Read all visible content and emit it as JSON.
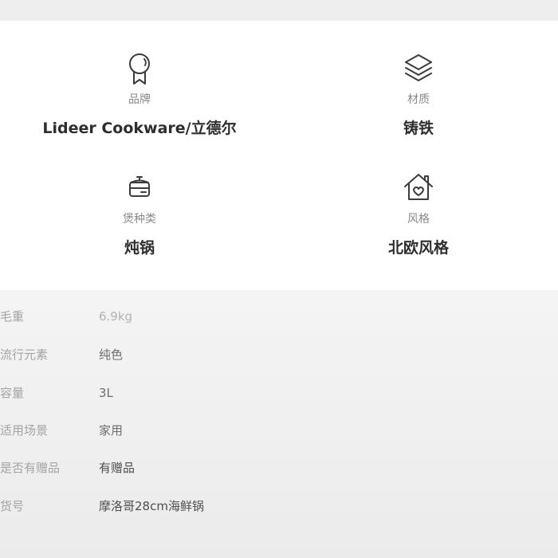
{
  "attributes": [
    {
      "icon": "award-ribbon-icon",
      "label": "品牌",
      "value": "Lideer Cookware/立德尔"
    },
    {
      "icon": "layers-icon",
      "label": "材质",
      "value": "铸铁"
    },
    {
      "icon": "pot-icon",
      "label": "煲种类",
      "value": "炖锅"
    },
    {
      "icon": "home-heart-icon",
      "label": "风格",
      "value": "北欧风格"
    }
  ],
  "specs": [
    {
      "key": "毛重",
      "value": "6.9kg"
    },
    {
      "key": "流行元素",
      "value": "纯色"
    },
    {
      "key": "容量",
      "value": "3L"
    },
    {
      "key": "适用场景",
      "value": "家用"
    },
    {
      "key": "是否有赠品",
      "value": "有赠品"
    },
    {
      "key": "货号",
      "value": "摩洛哥28cm海鲜锅"
    }
  ],
  "colors": {
    "card_bg": "#ffffff",
    "page_bg": "#f1f1f1",
    "label": "#8a8a8a",
    "value": "#2e2e2e",
    "icon": "#3c3c3c"
  }
}
